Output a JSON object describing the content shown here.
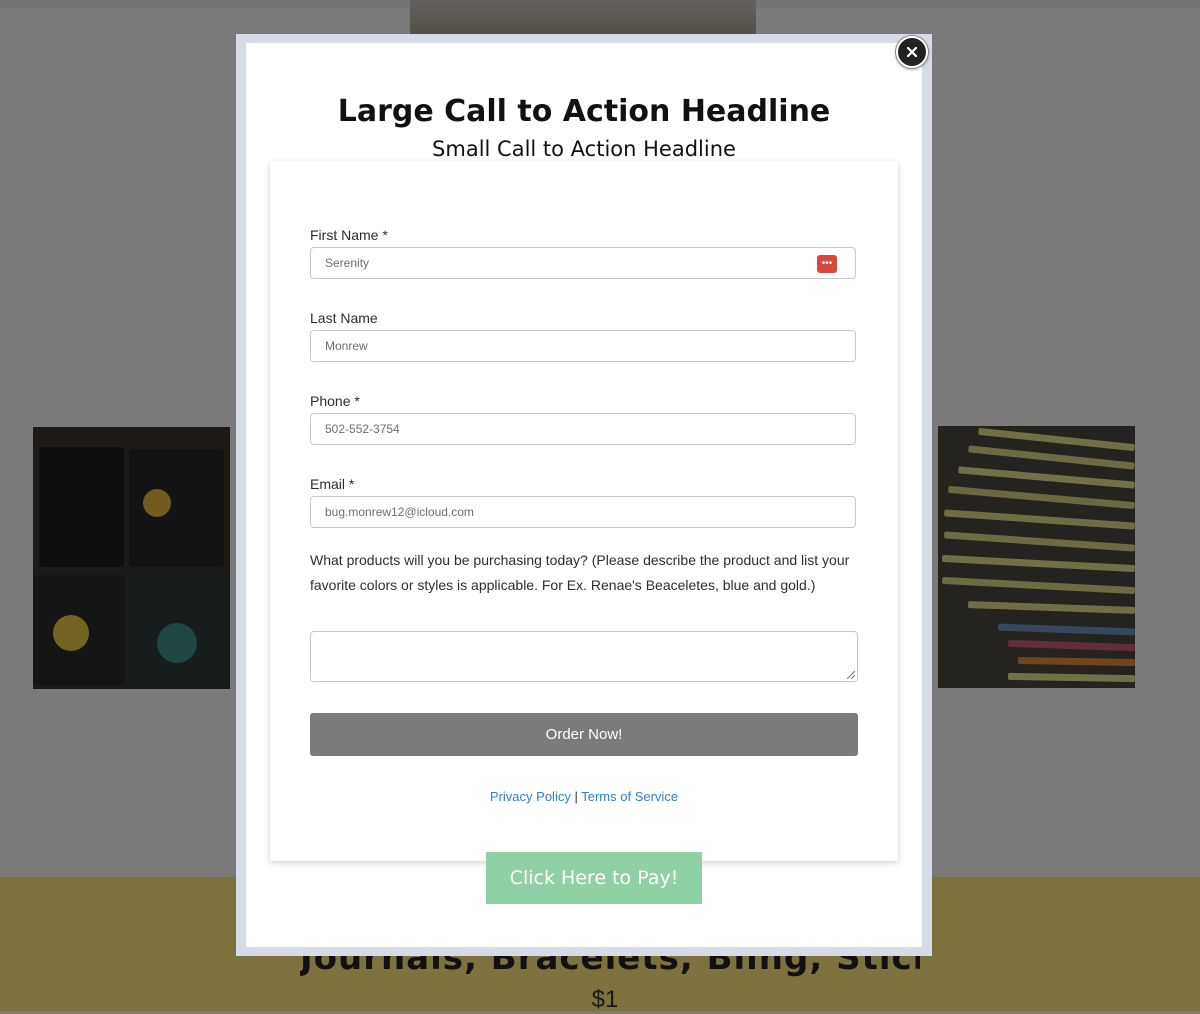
{
  "background": {
    "section_title": "Journals, Bracelets, Bling, Stickers, Pencils, Charms",
    "price": "$1",
    "accent_yellow": "#fae27a",
    "images": [
      {
        "icon": "notebooks-photo"
      },
      {
        "icon": "pencils-photo"
      }
    ]
  },
  "modal": {
    "headline_large": "Large Call to Action Headline",
    "headline_small": "Small Call to Action Headline",
    "close_icon": "close-icon",
    "form": {
      "first_name": {
        "label": "First Name *",
        "value": "Serenity"
      },
      "last_name": {
        "label": "Last Name",
        "value": "Monrew"
      },
      "phone": {
        "label": "Phone *",
        "value": "502-552-3754"
      },
      "email": {
        "label": "Email *",
        "value": "bug.monrew12@icloud.com"
      },
      "products_question": "What products will you be purchasing today? (Please describe the product and list your favorite colors or styles is applicable. For Ex. Renae's Beaceletes, blue and gold.)",
      "products_value": "",
      "submit_label": "Order Now!",
      "privacy_label": "Privacy Policy",
      "separator": "|",
      "terms_label": "Terms of Service",
      "submit_color": "#7b7b7b",
      "link_color": "#2f7fd0"
    },
    "pay_button_label": "Click Here to Pay!",
    "pay_button_color": "#8fd0a5"
  }
}
